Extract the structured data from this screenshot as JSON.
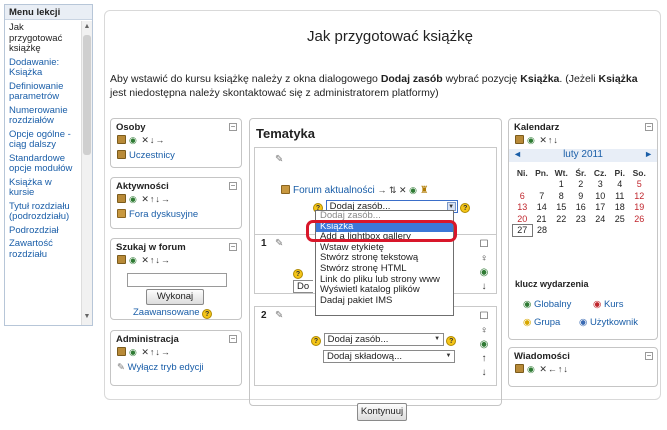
{
  "menu": {
    "title": "Menu lekcji",
    "items": [
      {
        "label": "Jak przygotować książkę",
        "current": true
      },
      {
        "label": "Dodawanie: Książka"
      },
      {
        "label": "Definiowanie parametrów"
      },
      {
        "label": "Numerowanie rozdziałów"
      },
      {
        "label": "Opcje ogólne - ciąg dalszy"
      },
      {
        "label": "Standardowe opcje modułów"
      },
      {
        "label": "Książka w kursie"
      },
      {
        "label": "Tytuł rozdziału (podrozdziału)"
      },
      {
        "label": "Podrozdział"
      },
      {
        "label": "Zawartość rozdziału"
      }
    ]
  },
  "page": {
    "title": "Jak przygotować książkę",
    "intro_1": "Aby wstawić do kursu książkę należy z okna dialogowego ",
    "intro_b1": "Dodaj zasób",
    "intro_2": " wybrać pozycję ",
    "intro_b2": "Książka",
    "intro_3": ". (Jeżeli ",
    "intro_b3": "Książka",
    "intro_4": " jest niedostępna należy skontaktować się z administratorem platformy)",
    "continue_button": "Kontynuuj"
  },
  "blocks": {
    "osoby": {
      "title": "Osoby",
      "controls": "✕↓→",
      "link": "Uczestnicy"
    },
    "aktywnosci": {
      "title": "Aktywności",
      "controls": "✕↑↓→",
      "link": "Fora dyskusyjne"
    },
    "szukaj": {
      "title": "Szukaj w forum",
      "controls": "✕↑↓→",
      "button": "Wykonaj",
      "advanced": "Zaawansowane"
    },
    "administracja": {
      "title": "Administracja",
      "controls": "✕↑↓→",
      "link": "Wyłącz tryb edycji"
    },
    "kalendarz": {
      "title": "Kalendarz",
      "controls": "✕↑↓",
      "month": "luty 2011",
      "prev": "◄",
      "next": "►"
    },
    "wiadomosci": {
      "title": "Wiadomości",
      "controls": "✕←↑↓"
    }
  },
  "topics": {
    "title": "Tematyka",
    "forum_link": "Forum aktualności",
    "forum_controls": "→ ⇅ ✕",
    "add_resource": "Dodaj zasób...",
    "add_activity": "Dodaj składową...",
    "add_activity_truncated": "Do",
    "section_1": "1",
    "section_2": "2"
  },
  "dropdown": {
    "options": [
      {
        "label": "Dodaj zasób...",
        "hint": true
      },
      {
        "label": "Książka",
        "highlighted": true
      },
      {
        "label": "Add a lightbox gallery"
      },
      {
        "label": "Wstaw etykietę"
      },
      {
        "label": "Stwórz stronę tekstową"
      },
      {
        "label": "Stwórz stronę HTML"
      },
      {
        "label": "Link do pliku lub strony www"
      },
      {
        "label": "Wyświetl katalog plików"
      },
      {
        "label": "Dadaj pakiet IMS"
      }
    ]
  },
  "calendar": {
    "weekdays": [
      "Ni.",
      "Pn.",
      "Wt.",
      "Śr.",
      "Cz.",
      "Pi.",
      "So."
    ],
    "weeks": [
      [
        "",
        "",
        "1",
        "2",
        "3",
        "4",
        "5"
      ],
      [
        "6",
        "7",
        "8",
        "9",
        "10",
        "11",
        "12"
      ],
      [
        "13",
        "14",
        "15",
        "16",
        "17",
        "18",
        "19"
      ],
      [
        "20",
        "21",
        "22",
        "23",
        "24",
        "25",
        "26"
      ],
      [
        "27",
        "28",
        "",
        "",
        "",
        "",
        ""
      ]
    ],
    "today": "27",
    "key_title": "klucz wydarzenia",
    "key_items": [
      "Globalny",
      "Kurs",
      "Grupa",
      "Użytkownik"
    ]
  },
  "colors": {
    "link": "#1a5ea8",
    "highlight": "#3b78d8",
    "callout": "#d8172a",
    "weekend": "#c0262d"
  }
}
